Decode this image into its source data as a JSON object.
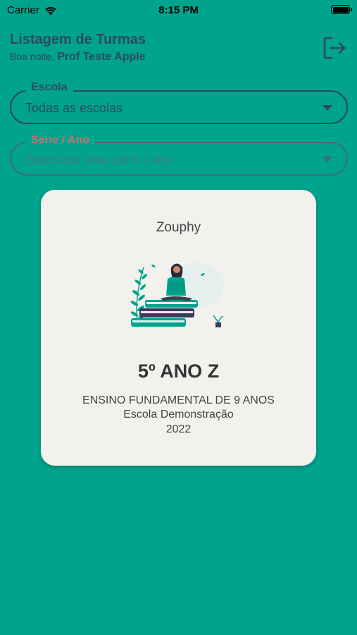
{
  "status_bar": {
    "carrier": "Carrier",
    "time": "8:15 PM",
    "battery_level": 1.0
  },
  "header": {
    "title": "Listagem de Turmas",
    "greeting": "Boa noite,",
    "user_name": "Prof Teste Apple",
    "logout_icon": "logout-icon"
  },
  "filters": {
    "escola": {
      "label": "Escola",
      "value": "Todas as escolas"
    },
    "serie": {
      "label": "Série / Ano",
      "placeholder": "Selecione uma série / ano"
    }
  },
  "card": {
    "brand": "Zouphy",
    "class_name": "5º ANO Z",
    "level": "ENSINO FUNDAMENTAL DE 9 ANOS",
    "school": "Escola Demonstração",
    "year": "2022",
    "illustration": "person-reading-on-books-illustration"
  },
  "colors": {
    "background": "#00A48C",
    "text_dark": "#2E4A5A",
    "card_background": "#F2F1EE",
    "serie_label": "#C9706F"
  }
}
